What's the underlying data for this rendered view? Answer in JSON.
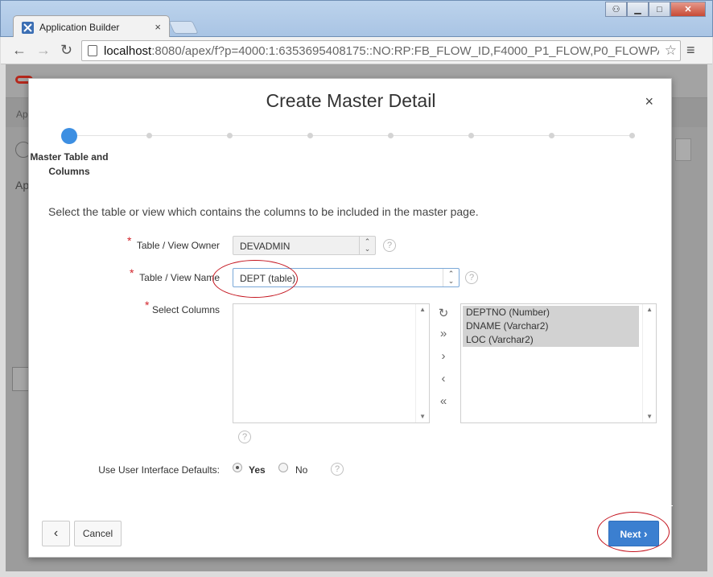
{
  "browser": {
    "tab_title": "Application Builder",
    "tab_close": "×",
    "url_host": "localhost",
    "url_path": ":8080/apex/f?p=4000:1:6353695408175::NO:RP:FB_FLOW_ID,F4000_P1_FLOW,P0_FLOWPA",
    "back_icon": "←",
    "forward_icon": "→",
    "reload_icon": "↻",
    "star_icon": "☆",
    "menu_icon": "≡",
    "win_minimize": "▁",
    "win_maximize": "□",
    "win_close": "✕",
    "win_user": "⚇"
  },
  "background_page": {
    "frag1": "Ap",
    "frag2": "Ap"
  },
  "dialog": {
    "title": "Create Master Detail",
    "close_icon": "×",
    "wizard_step_label": "Master Table and Columns",
    "intro": "Select the table or view which contains the columns to be included in the master page.",
    "fields": {
      "owner_label": "Table / View Owner",
      "owner_value": "DEVADMIN",
      "name_label": "Table / View Name",
      "name_value": "DEPT (table)",
      "columns_label": "Select Columns",
      "required_marker": "*",
      "help_glyph": "?"
    },
    "shuttle": {
      "available": [],
      "selected": [
        "DEPTNO (Number)",
        "DNAME (Varchar2)",
        "LOC (Varchar2)"
      ],
      "reset_icon": "↻",
      "move_all_icon": "»",
      "move_icon": "›",
      "remove_icon": "‹",
      "remove_all_icon": "«"
    },
    "ui_defaults": {
      "label": "Use User Interface Defaults:",
      "yes": "Yes",
      "no": "No",
      "selected": "Yes"
    },
    "footer": {
      "prev_icon": "‹",
      "cancel_label": "Cancel",
      "next_label": "Next",
      "next_icon": "›"
    }
  },
  "colors": {
    "accent": "#3b7fd0",
    "wizard_active": "#3d8fe2",
    "required": "#d2232a",
    "annotation": "#c4141e"
  }
}
